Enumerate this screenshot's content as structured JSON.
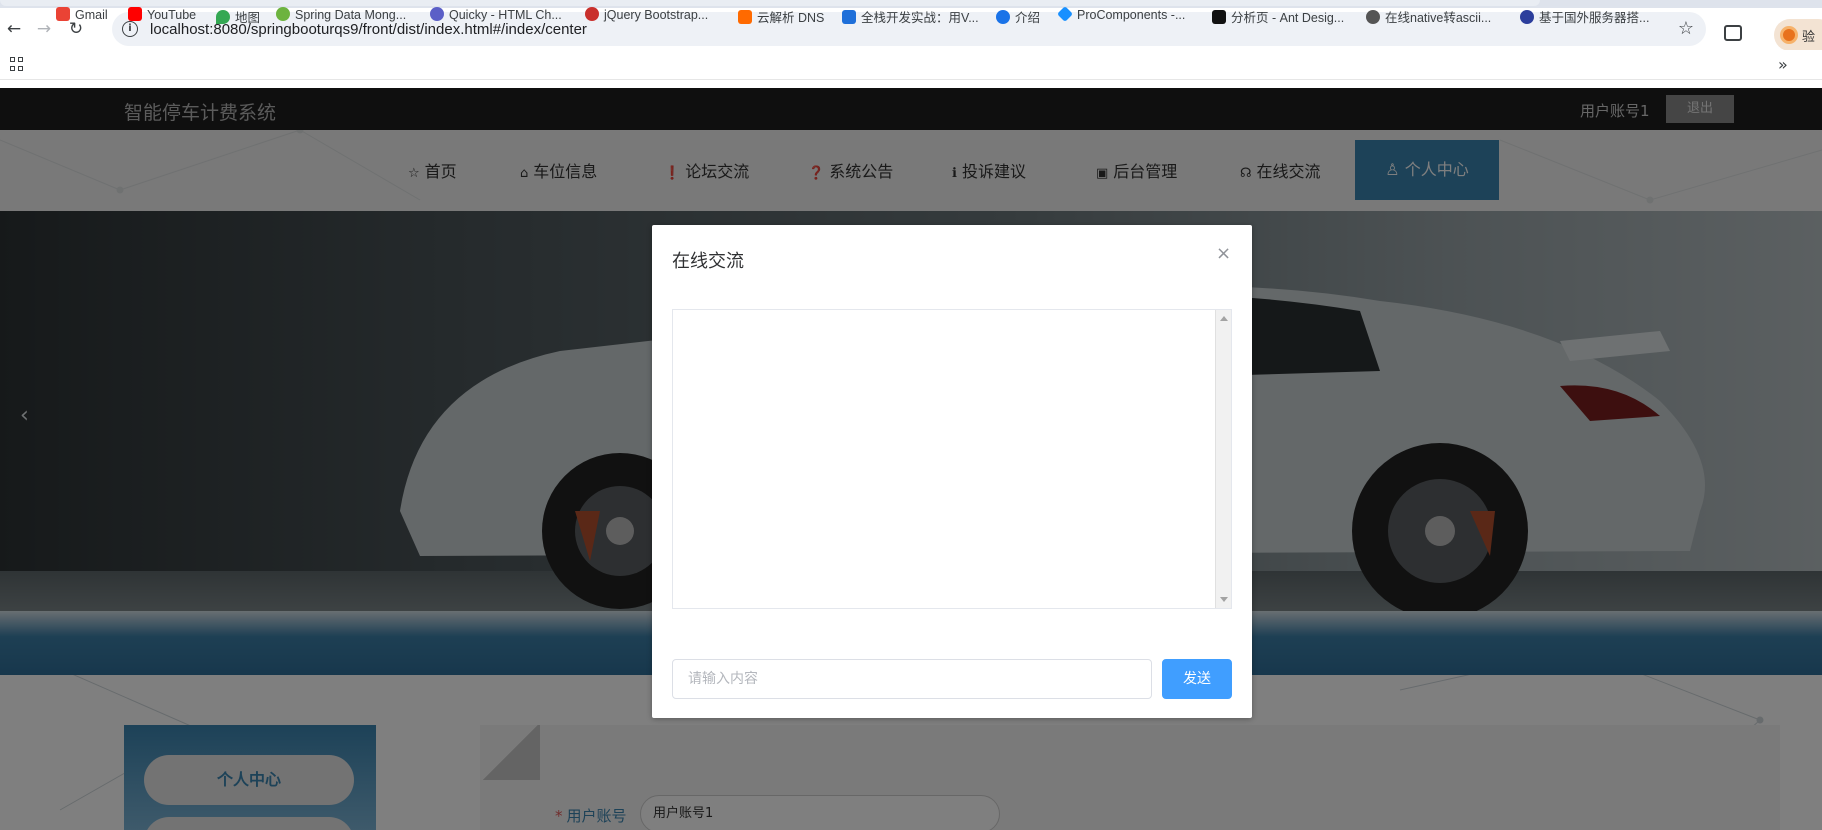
{
  "browser": {
    "url": "localhost:8080/springbooturqs9/front/dist/index.html#/index/center",
    "profile_label": "验"
  },
  "bookmarks": [
    {
      "label": "Gmail",
      "color": "#ea4335"
    },
    {
      "label": "YouTube",
      "color": "#ff0000"
    },
    {
      "label": "地图",
      "color": "#34a853"
    },
    {
      "label": "Spring Data Mong...",
      "color": "#6db33f"
    },
    {
      "label": "Quicky - HTML Ch...",
      "color": "#5b5fc7"
    },
    {
      "label": "jQuery Bootstrap...",
      "color": "#c9302c"
    },
    {
      "label": "云解析 DNS",
      "color": "#ff6a00"
    },
    {
      "label": "全栈开发实战：用V...",
      "color": "#1e6fd9"
    },
    {
      "label": "介绍",
      "color": "#1a73e8"
    },
    {
      "label": "ProComponents -...",
      "color": "#1890ff"
    },
    {
      "label": "分析页 - Ant Desig...",
      "color": "#111111"
    },
    {
      "label": "在线native转ascii...",
      "color": "#555555"
    },
    {
      "label": "基于国外服务器搭...",
      "color": "#2c3e9c"
    }
  ],
  "site": {
    "title": "智能停车计费系统",
    "user": "用户账号1",
    "logout_label": "退出"
  },
  "nav": {
    "items": [
      {
        "label": "首页",
        "icon": "☆"
      },
      {
        "label": "车位信息",
        "icon": "⌂"
      },
      {
        "label": "论坛交流",
        "icon": "❗"
      },
      {
        "label": "系统公告",
        "icon": "❓"
      },
      {
        "label": "投诉建议",
        "icon": "ℹ"
      },
      {
        "label": "后台管理",
        "icon": "▣"
      },
      {
        "label": "在线交流",
        "icon": "☊"
      }
    ],
    "active": {
      "label": "个人中心",
      "icon": "♙"
    }
  },
  "sidebar": {
    "active_label": "个人中心"
  },
  "form": {
    "account_label": "用户账号",
    "account_value": "用户账号1"
  },
  "modal": {
    "title": "在线交流",
    "close_icon": "×",
    "input_placeholder": "请输入内容",
    "send_label": "发送"
  },
  "colors": {
    "accent": "#3a84b0",
    "send_button": "#409eff",
    "header_bg": "#1f1f1f"
  }
}
